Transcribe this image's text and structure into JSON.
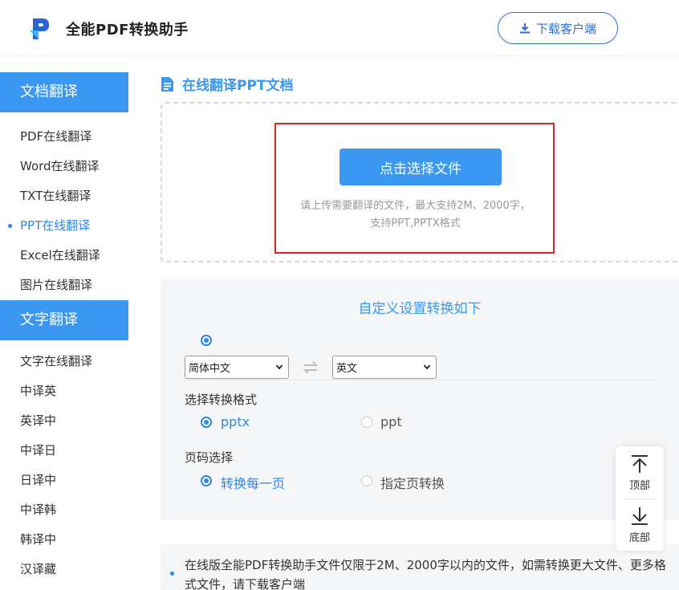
{
  "header": {
    "app_title": "全能PDF转换助手",
    "download_label": "下载客户端"
  },
  "sidebar": {
    "doc_header": "文档翻译",
    "doc_items": [
      {
        "label": "PDF在线翻译"
      },
      {
        "label": "Word在线翻译"
      },
      {
        "label": "TXT在线翻译"
      },
      {
        "label": "PPT在线翻译"
      },
      {
        "label": "Excel在线翻译"
      },
      {
        "label": "图片在线翻译"
      }
    ],
    "text_header": "文字翻译",
    "text_items": [
      {
        "label": "文字在线翻译"
      },
      {
        "label": "中译英"
      },
      {
        "label": "英译中"
      },
      {
        "label": "中译日"
      },
      {
        "label": "日译中"
      },
      {
        "label": "中译韩"
      },
      {
        "label": "韩译中"
      },
      {
        "label": "汉译藏"
      }
    ]
  },
  "main": {
    "section_title": "在线翻译PPT文档",
    "upload": {
      "button_label": "点击选择文件",
      "hint_line1": "请上传需要翻译的文件，最大支持2M、2000字，",
      "hint_line2": "支持PPT,PPTX格式"
    },
    "settings": {
      "title": "自定义设置转换如下",
      "source_lang": "简体中文",
      "target_lang": "英文",
      "format_label": "选择转换格式",
      "format_options": [
        {
          "label": "pptx",
          "selected": true
        },
        {
          "label": "ppt",
          "selected": false
        }
      ],
      "page_label": "页码选择",
      "page_options": [
        {
          "label": "转换每一页",
          "selected": true
        },
        {
          "label": "指定页转换",
          "selected": false
        }
      ]
    },
    "notice_text": "在线版全能PDF转换助手文件仅限于2M、2000字以内的文件，如需转换更大文件、更多格式文件，请下载客户端"
  },
  "float_tools": {
    "top_label": "顶部",
    "bottom_label": "底部"
  },
  "colors": {
    "accent": "#3a97f2",
    "link": "#2f86e8",
    "highlight": "#e02020"
  }
}
